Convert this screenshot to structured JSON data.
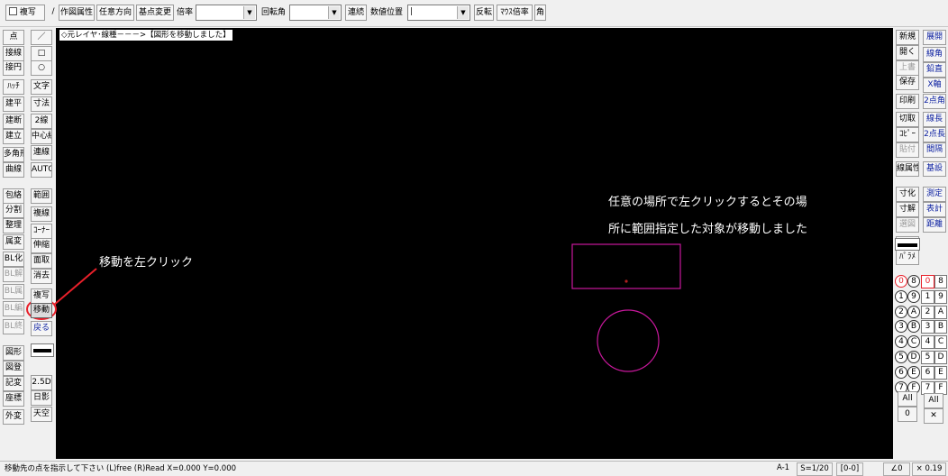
{
  "toolbar": {
    "fukusha": "複写",
    "line_icon": "/",
    "sakuzu_zokusei": "作図属性",
    "nin_i_houkou": "任意方向",
    "kiten_henkou": "基点変更",
    "bairitsu_label": "倍率",
    "bairitsu_value": "",
    "kaitenkaku_label": "回転角",
    "kaitenkaku_value": "",
    "renzoku": "連続",
    "suuchi_ichi_label": "数値位置",
    "suuchi_ichi_value": "|",
    "hanten": "反転",
    "mouse_bairitsu": "ﾏｳｽ倍率",
    "kaku": "角"
  },
  "left_col1": [
    "点",
    "接線",
    "接円",
    "ﾊｯﾁ",
    "建平",
    "建断",
    "建立",
    "多角形",
    "曲線",
    "包絡",
    "分割",
    "整理",
    "属変",
    "BL化",
    "BL解",
    "BL属",
    "BL編",
    "BL終",
    "図形",
    "図登",
    "記変",
    "座標",
    "外変"
  ],
  "left_col2": [
    "／",
    "□",
    "○",
    "文字",
    "寸法",
    "2線",
    "中心線",
    "連線",
    "AUTO",
    "範囲",
    "複線",
    "ｺｰﾅｰ",
    "伸縮",
    "面取",
    "消去",
    "複写",
    "移動",
    "戻る",
    "",
    "2.5D",
    "日影",
    "天空"
  ],
  "right_col1": [
    "新規",
    "開く",
    "上書",
    "保存",
    "印刷",
    "切取",
    "ｺﾋﾟｰ",
    "貼付",
    "線属性",
    "寸化",
    "寸解",
    "選図",
    "式計",
    "ﾊﾟﾗﾒ"
  ],
  "right_col2": [
    "展開",
    "線角",
    "鉛直",
    "X軸",
    "2点角",
    "線長",
    "2点長",
    "間隔",
    "基設",
    "測定",
    "表計",
    "距離"
  ],
  "layer_circles": [
    "0",
    "1",
    "2",
    "3",
    "4",
    "5",
    "6",
    "7"
  ],
  "layer_circles_b": [
    "8",
    "9",
    "A",
    "B",
    "C",
    "D",
    "E",
    "F"
  ],
  "group_nums": [
    "0",
    "1",
    "2",
    "3",
    "4",
    "5",
    "6",
    "7"
  ],
  "group_nums_b": [
    "8",
    "9",
    "A",
    "B",
    "C",
    "D",
    "E",
    "F"
  ],
  "all_label": "All",
  "all_zero": "0",
  "all_label2": "All",
  "canvas": {
    "layer_info": "◇元レイヤ･線種－－－>【図形を移動しました】",
    "annotation_left": "移動を左クリック",
    "annotation_right_1": "任意の場所で左クリックするとその場",
    "annotation_right_2": "所に範囲指定した対象が移動しました"
  },
  "status": {
    "message": "移動先の点を指示して下さい (L)free (R)Read X=0.000 Y=0.000",
    "layer": "A-1",
    "scale": "S=1/20",
    "group": "[0-0]",
    "angle": "∠0",
    "zoom": "× 0.19"
  },
  "colors": {
    "canvas_bg": "#000000",
    "shape_stroke": "#c8189c",
    "highlight_circle": "#e8202a",
    "red_arrow": "#e8202a"
  }
}
